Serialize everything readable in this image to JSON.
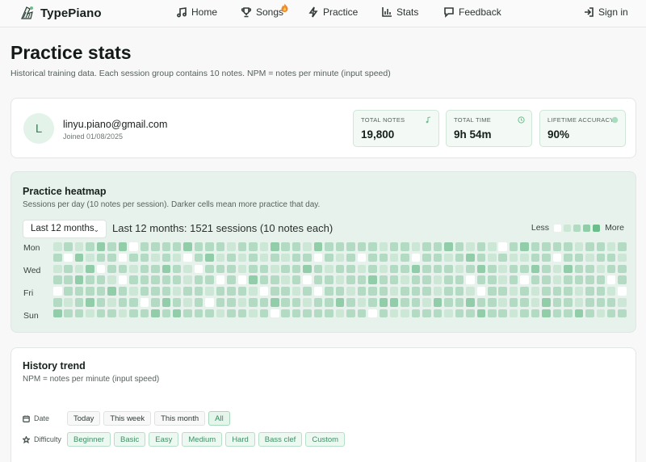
{
  "brand": {
    "name": "TypePiano"
  },
  "nav": {
    "home": "Home",
    "songs": "Songs",
    "practice": "Practice",
    "stats": "Stats",
    "feedback": "Feedback",
    "sign_in": "Sign in"
  },
  "page": {
    "title": "Practice stats",
    "subtitle": "Historical training data. Each session group contains 10 notes. NPM = notes per minute (input speed)"
  },
  "profile": {
    "avatar_initial": "L",
    "email": "linyu.piano@gmail.com",
    "joined": "Joined 01/08/2025",
    "stats": [
      {
        "label": "Total notes",
        "value": "19,800",
        "icon": "music-note-icon"
      },
      {
        "label": "Total time",
        "value": "9h 54m",
        "icon": "clock-icon"
      },
      {
        "label": "Lifetime accuracy",
        "value": "90%",
        "icon": "dot-icon"
      }
    ]
  },
  "heatmap": {
    "title": "Practice heatmap",
    "subtitle": "Sessions per day (10 notes per session). Darker cells mean more practice that day.",
    "range_selected": "Last 12 months",
    "summary": "Last 12 months: 1521 sessions (10 notes each)",
    "legend_less": "Less",
    "legend_more": "More",
    "day_labels": [
      "Mon",
      "Wed",
      "Fri",
      "Sun"
    ],
    "colors": [
      "#ffffff",
      "#cde7d7",
      "#b3dbc3",
      "#92cda9",
      "#6bbd8c"
    ],
    "weeks": 53,
    "levels": [
      [
        1,
        2,
        1,
        2,
        3,
        2,
        3,
        0,
        2,
        2,
        2,
        2,
        3,
        2,
        2,
        2,
        1,
        2,
        2,
        1,
        3,
        2,
        2,
        1,
        3,
        2,
        2,
        2,
        2,
        2,
        1,
        2,
        2,
        1,
        2,
        2,
        3,
        2,
        1,
        2,
        1,
        0,
        2,
        3,
        2,
        2,
        2,
        2,
        1,
        2,
        2,
        1,
        2
      ],
      [
        2,
        0,
        3,
        1,
        2,
        2,
        0,
        2,
        2,
        1,
        2,
        1,
        0,
        2,
        3,
        1,
        2,
        1,
        2,
        1,
        2,
        1,
        2,
        2,
        0,
        2,
        1,
        2,
        0,
        2,
        2,
        1,
        2,
        0,
        2,
        2,
        1,
        2,
        3,
        2,
        1,
        2,
        1,
        1,
        2,
        2,
        0,
        2,
        2,
        1,
        2,
        2,
        1
      ],
      [
        1,
        2,
        1,
        3,
        0,
        2,
        2,
        1,
        2,
        2,
        3,
        2,
        1,
        0,
        2,
        2,
        2,
        1,
        2,
        2,
        1,
        2,
        2,
        3,
        2,
        1,
        2,
        2,
        1,
        2,
        1,
        2,
        2,
        3,
        2,
        2,
        2,
        1,
        2,
        3,
        2,
        1,
        2,
        2,
        3,
        2,
        1,
        3,
        2,
        2,
        1,
        2,
        2
      ],
      [
        2,
        2,
        3,
        2,
        2,
        1,
        0,
        2,
        2,
        2,
        2,
        2,
        1,
        2,
        2,
        0,
        2,
        0,
        3,
        2,
        2,
        1,
        2,
        0,
        2,
        2,
        1,
        2,
        2,
        3,
        2,
        2,
        1,
        2,
        2,
        1,
        2,
        2,
        0,
        2,
        2,
        1,
        2,
        0,
        2,
        2,
        1,
        2,
        2,
        2,
        2,
        0,
        2
      ],
      [
        0,
        2,
        2,
        2,
        2,
        3,
        2,
        1,
        2,
        2,
        2,
        1,
        2,
        2,
        1,
        2,
        2,
        2,
        1,
        0,
        2,
        2,
        1,
        2,
        0,
        2,
        2,
        1,
        2,
        2,
        2,
        1,
        2,
        2,
        2,
        1,
        2,
        2,
        1,
        0,
        2,
        2,
        1,
        2,
        1,
        2,
        2,
        2,
        1,
        2,
        2,
        1,
        0
      ],
      [
        2,
        1,
        2,
        3,
        2,
        1,
        2,
        2,
        0,
        2,
        3,
        2,
        1,
        2,
        0,
        2,
        2,
        1,
        2,
        2,
        3,
        2,
        2,
        1,
        2,
        2,
        3,
        2,
        1,
        2,
        3,
        3,
        2,
        2,
        1,
        3,
        2,
        2,
        3,
        2,
        2,
        1,
        2,
        2,
        1,
        3,
        2,
        2,
        1,
        2,
        2,
        2,
        1
      ],
      [
        3,
        2,
        2,
        1,
        2,
        2,
        1,
        2,
        2,
        3,
        2,
        3,
        2,
        2,
        2,
        1,
        2,
        2,
        1,
        2,
        0,
        2,
        2,
        2,
        2,
        2,
        1,
        2,
        2,
        0,
        2,
        1,
        1,
        2,
        2,
        2,
        1,
        2,
        2,
        3,
        2,
        2,
        1,
        2,
        2,
        3,
        2,
        2,
        3,
        2,
        1,
        2,
        2
      ]
    ]
  },
  "history": {
    "title": "History trend",
    "subtitle": "NPM = notes per minute (input speed)",
    "date_label": "Date",
    "date_options": [
      "Today",
      "This week",
      "This month",
      "All"
    ],
    "date_selected": "All",
    "difficulty_label": "Difficulty",
    "difficulty_options": [
      "Beginner",
      "Basic",
      "Easy",
      "Medium",
      "Hard",
      "Bass clef",
      "Custom"
    ]
  },
  "theme": {
    "accent": "#2f8a5a"
  }
}
